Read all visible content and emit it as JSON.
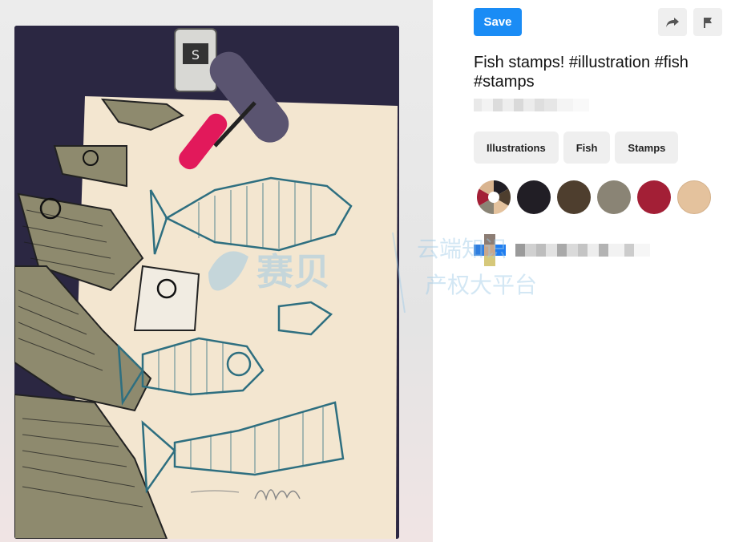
{
  "toolbar": {
    "save_label": "Save",
    "share_icon": "share-arrow-icon",
    "report_icon": "flag-icon"
  },
  "pin": {
    "title": "Fish stamps! #illustration #fish #stamps"
  },
  "tags": [
    {
      "label": "Illustrations"
    },
    {
      "label": "Fish"
    },
    {
      "label": "Stamps"
    }
  ],
  "colors": {
    "accent": "#1a8cf5",
    "swatches": [
      "#211e25",
      "#4e3e2e",
      "#8a8475",
      "#a31f36",
      "#e4c29d"
    ]
  },
  "watermark": {
    "brand": "赛贝",
    "line1": "云端知识",
    "line2": "产权大平台"
  }
}
